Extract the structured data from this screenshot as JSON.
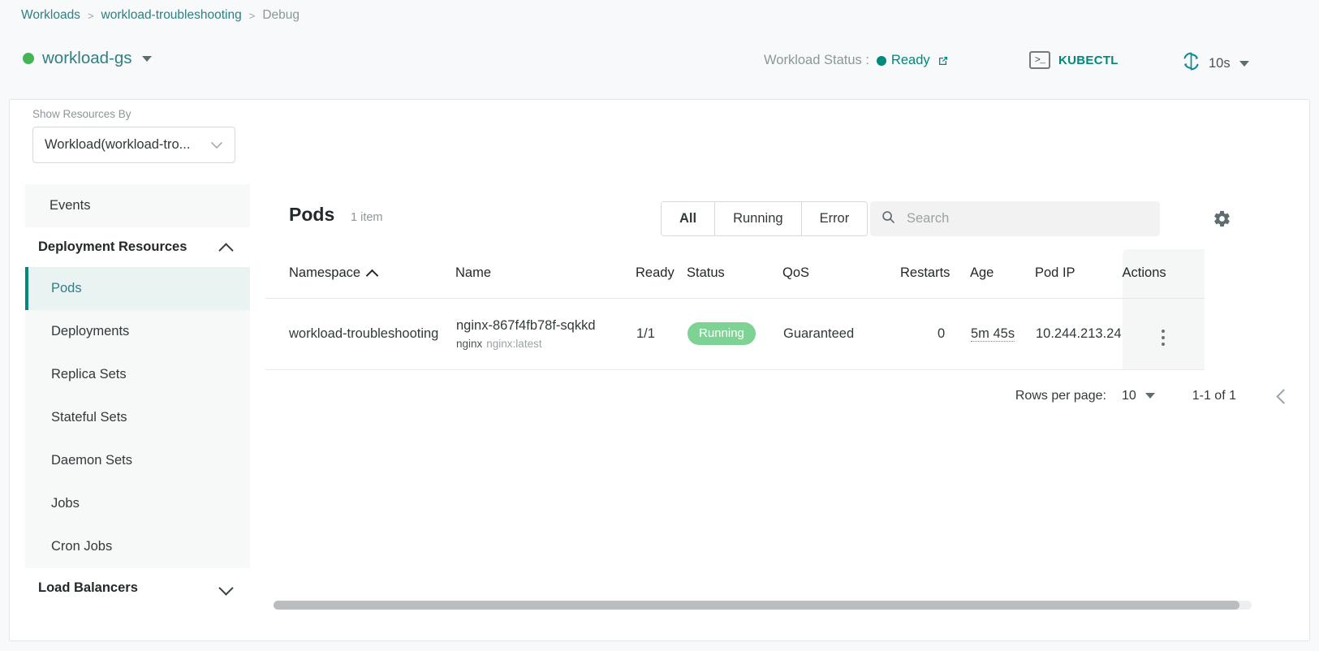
{
  "breadcrumb": {
    "items": [
      {
        "label": "Workloads",
        "current": false
      },
      {
        "label": "workload-troubleshooting",
        "current": false
      },
      {
        "label": "Debug",
        "current": true
      }
    ],
    "separator": ">"
  },
  "header": {
    "workload_name": "workload-gs",
    "workload_status_label": "Workload Status :",
    "workload_status_value": "Ready",
    "kubectl_label": "KUBECTL",
    "refresh_interval": "10s",
    "status_dot_color": "#44b556",
    "status_text_color": "#00897b",
    "accent_color": "#00897b"
  },
  "show_resources_by": {
    "label": "Show Resources By",
    "value": "Workload(workload-tro..."
  },
  "sidebar": {
    "events_label": "Events",
    "groups": [
      {
        "label": "Deployment Resources",
        "expanded": true,
        "items": [
          {
            "label": "Pods",
            "active": true
          },
          {
            "label": "Deployments",
            "active": false
          },
          {
            "label": "Replica Sets",
            "active": false
          },
          {
            "label": "Stateful Sets",
            "active": false
          },
          {
            "label": "Daemon Sets",
            "active": false
          },
          {
            "label": "Jobs",
            "active": false
          },
          {
            "label": "Cron Jobs",
            "active": false
          }
        ]
      },
      {
        "label": "Load Balancers",
        "expanded": false,
        "items": []
      }
    ]
  },
  "table": {
    "title": "Pods",
    "count_label": "1 item",
    "filters": [
      {
        "label": "All",
        "active": true
      },
      {
        "label": "Running",
        "active": false
      },
      {
        "label": "Error",
        "active": false
      }
    ],
    "search_placeholder": "Search",
    "search_value": "",
    "columns": [
      {
        "label": "Namespace",
        "sort": "asc"
      },
      {
        "label": "Name",
        "sort": null
      },
      {
        "label": "Ready",
        "sort": null
      },
      {
        "label": "Status",
        "sort": null
      },
      {
        "label": "QoS",
        "sort": null
      },
      {
        "label": "Restarts",
        "sort": null
      },
      {
        "label": "Age",
        "sort": null
      },
      {
        "label": "Pod IP",
        "sort": null
      },
      {
        "label": "Actions",
        "sort": null
      }
    ],
    "rows": [
      {
        "namespace": "workload-troubleshooting",
        "name": "nginx-867f4fb78f-sqkkd",
        "container": "nginx",
        "image": "nginx:latest",
        "ready": "1/1",
        "status": "Running",
        "status_color": "#7ed294",
        "qos": "Guaranteed",
        "restarts": "0",
        "age": "5m 45s",
        "pod_ip": "10.244.213.24"
      }
    ]
  },
  "pagination": {
    "rows_per_page_label": "Rows per page:",
    "rows_per_page_value": "10",
    "range_label": "1-1 of 1"
  }
}
